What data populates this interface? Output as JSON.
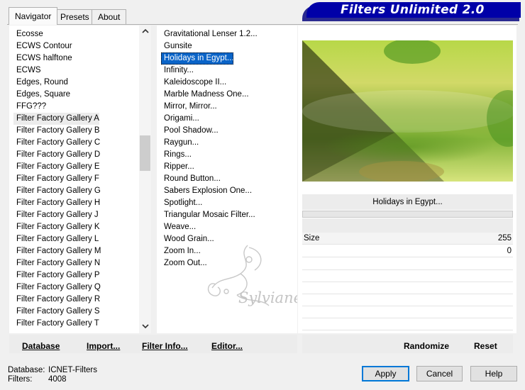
{
  "tabs": [
    "Navigator",
    "Presets",
    "About"
  ],
  "banner": "Filters Unlimited 2.0",
  "categories": [
    "Ecosse",
    "ECWS Contour",
    "ECWS halftone",
    "ECWS",
    "Edges, Round",
    "Edges, Square",
    "FFG???",
    "Filter Factory Gallery A",
    "Filter Factory Gallery B",
    "Filter Factory Gallery C",
    "Filter Factory Gallery D",
    "Filter Factory Gallery E",
    "Filter Factory Gallery F",
    "Filter Factory Gallery G",
    "Filter Factory Gallery H",
    "Filter Factory Gallery J",
    "Filter Factory Gallery K",
    "Filter Factory Gallery L",
    "Filter Factory Gallery M",
    "Filter Factory Gallery N",
    "Filter Factory Gallery P",
    "Filter Factory Gallery Q",
    "Filter Factory Gallery R",
    "Filter Factory Gallery S",
    "Filter Factory Gallery T"
  ],
  "selected_category": "Filter Factory Gallery A",
  "filters": [
    "Gravitational Lenser 1.2...",
    "Gunsite",
    "Holidays in Egypt...",
    "Infinity...",
    "Kaleidoscope II...",
    "Marble Madness One...",
    "Mirror, Mirror...",
    "Origami...",
    "Pool Shadow...",
    "Raygun...",
    "Rings...",
    "Ripper...",
    "Round Button...",
    "Sabers Explosion One...",
    "Spotlight...",
    "Triangular Mosaic Filter...",
    "Weave...",
    "Wood Grain...",
    "Zoom In...",
    "Zoom Out..."
  ],
  "selected_filter": "Holidays in Egypt...",
  "filter_name": "Holidays in Egypt...",
  "params": [
    {
      "label": "Size",
      "value": "255"
    },
    {
      "label": "",
      "value": "0"
    }
  ],
  "watermark": "Sylviane",
  "toolbar": {
    "database": "Database",
    "import": "Import...",
    "filter_info": "Filter Info...",
    "editor": "Editor...",
    "randomize": "Randomize",
    "reset": "Reset"
  },
  "status": {
    "database_label": "Database:",
    "database_value": "ICNET-Filters",
    "filters_label": "Filters:",
    "filters_value": "4008"
  },
  "buttons": {
    "apply": "Apply",
    "cancel": "Cancel",
    "help": "Help"
  },
  "icons": {
    "scroll_up": "chevron-up-icon",
    "scroll_down": "chevron-down-icon"
  },
  "colors": {
    "banner": "#0000a8",
    "selection": "#0a64c8"
  }
}
